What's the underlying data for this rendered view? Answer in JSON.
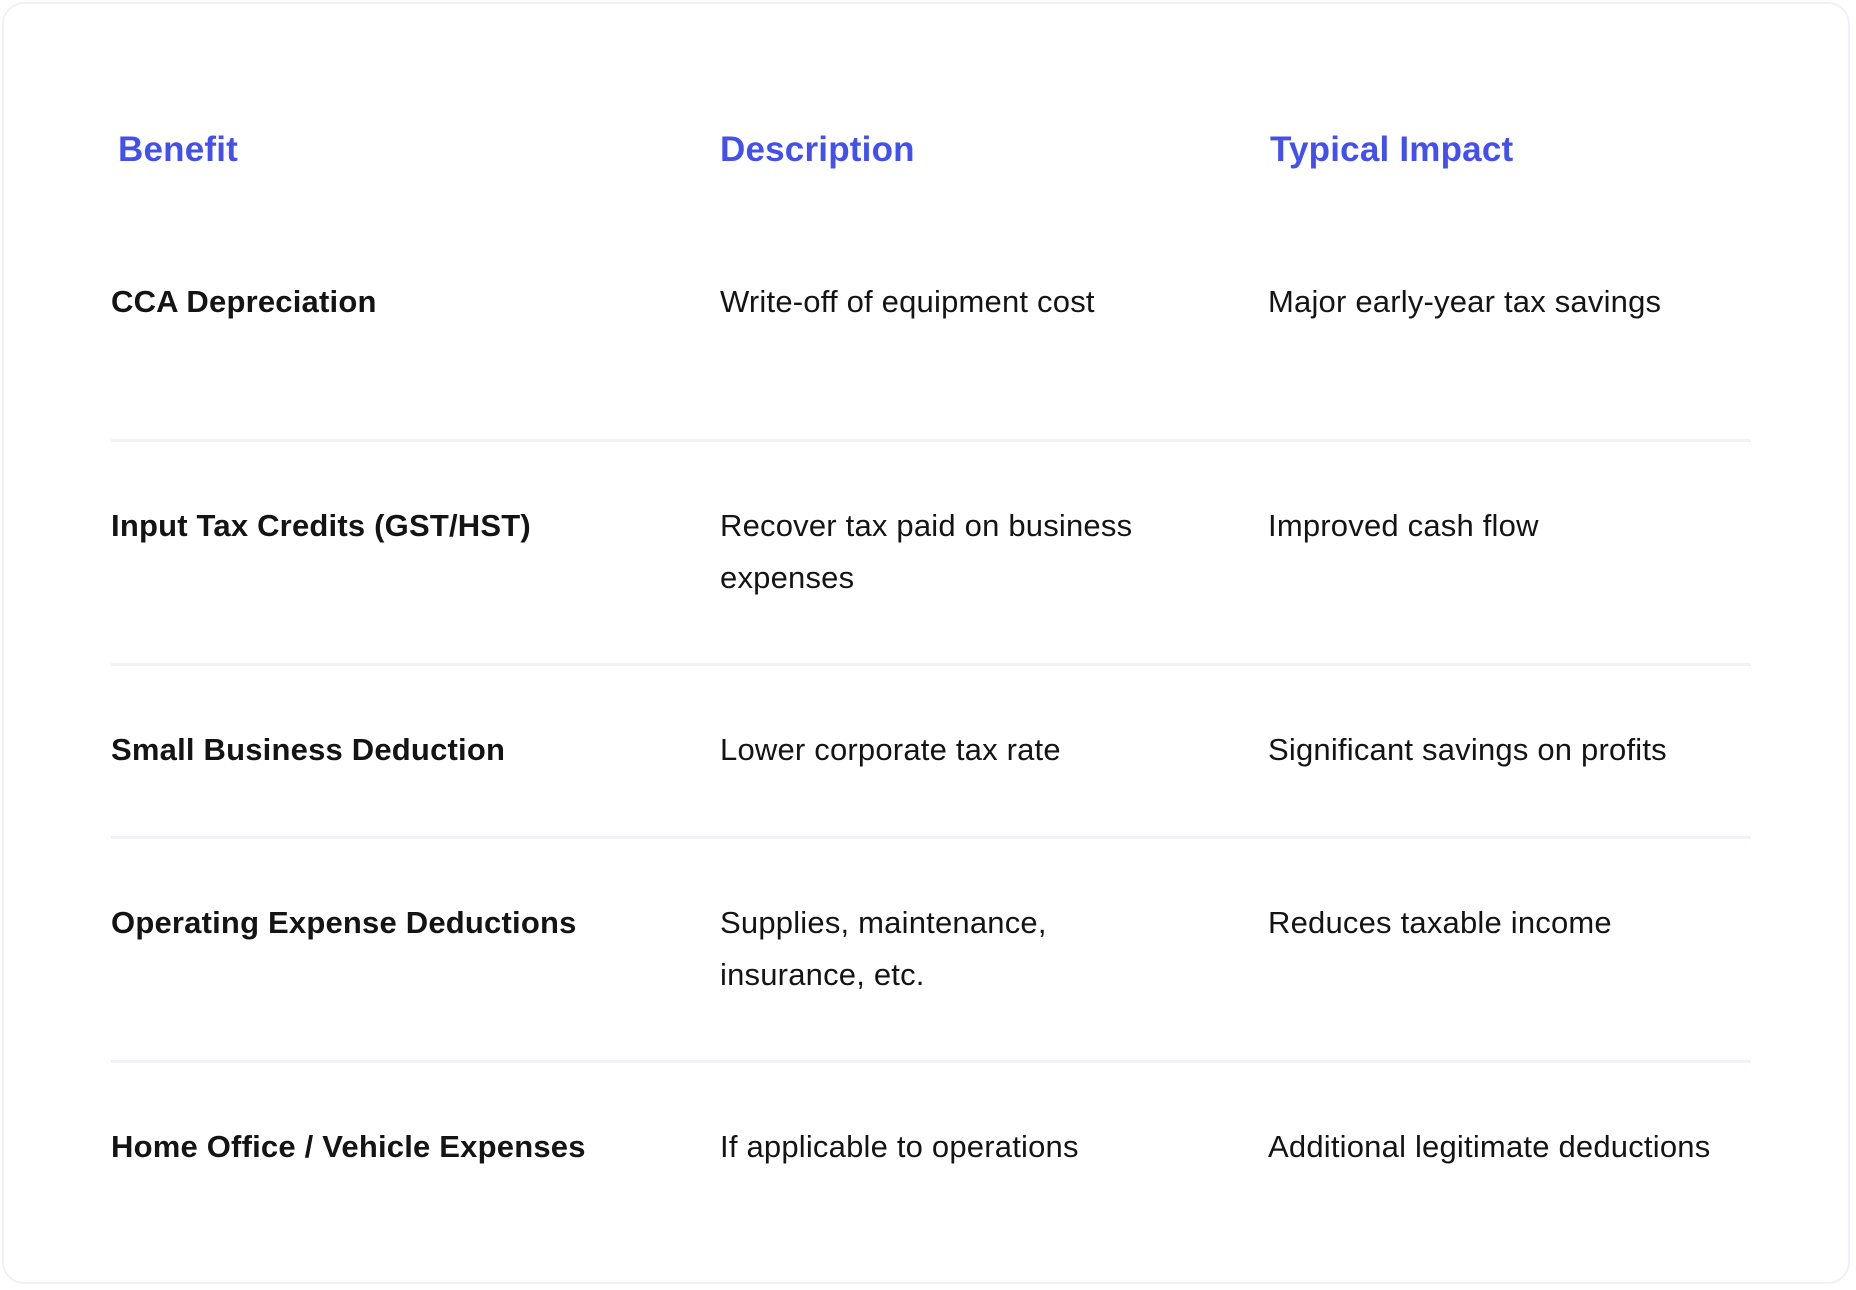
{
  "table": {
    "headers": {
      "benefit": "Benefit",
      "description": "Description",
      "impact": "Typical Impact"
    },
    "rows": [
      {
        "benefit": "CCA Depreciation",
        "description": "Write-off of equipment cost",
        "impact": "Major early-year tax savings"
      },
      {
        "benefit": "Input Tax Credits (GST/HST)",
        "description": "Recover tax paid on business expenses",
        "impact": "Improved cash flow"
      },
      {
        "benefit": "Small Business Deduction",
        "description": "Lower corporate tax rate",
        "impact": "Significant savings on profits"
      },
      {
        "benefit": "Operating Expense Deductions",
        "description": "Supplies, maintenance, insurance, etc.",
        "impact": "Reduces taxable income"
      },
      {
        "benefit": "Home Office / Vehicle Expenses",
        "description": "If applicable to operations",
        "impact": "Additional legitimate deductions"
      }
    ]
  },
  "colors": {
    "header_text": "#4350ec",
    "body_text": "#141414",
    "divider": "#f1f1fa",
    "card_border": "#f0f0fa"
  }
}
